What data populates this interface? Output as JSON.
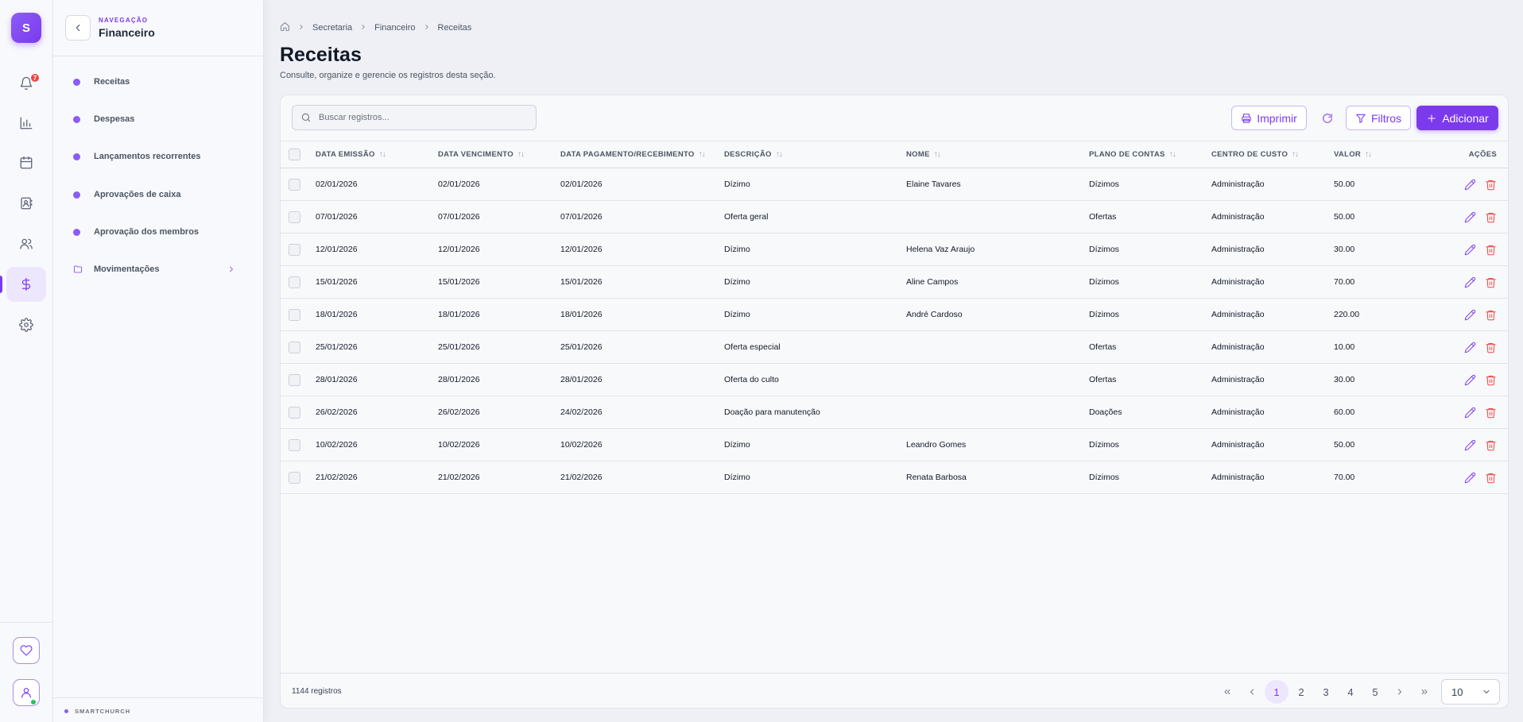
{
  "app": {
    "logo_letter": "S",
    "brand": "SMARTCHURCH"
  },
  "rail": {
    "notifications_count": "7"
  },
  "sidenav": {
    "kicker": "NAVEGAÇÃO",
    "title": "Financeiro",
    "items": [
      {
        "label": "Receitas"
      },
      {
        "label": "Despesas"
      },
      {
        "label": "Lançamentos recorrentes"
      },
      {
        "label": "Aprovações de caixa"
      },
      {
        "label": "Aprovação dos membros"
      },
      {
        "label": "Movimentações"
      }
    ]
  },
  "breadcrumb": [
    "Secretaria",
    "Financeiro",
    "Receitas"
  ],
  "page": {
    "title": "Receitas",
    "subtitle": "Consulte, organize e gerencie os registros desta seção."
  },
  "toolbar": {
    "search_placeholder": "Buscar registros...",
    "print_label": "Imprimir",
    "filters_label": "Filtros",
    "add_label": "Adicionar"
  },
  "table": {
    "columns": [
      "DATA EMISSÃO",
      "DATA VENCIMENTO",
      "DATA PAGAMENTO/RECEBIMENTO",
      "DESCRIÇÃO",
      "NOME",
      "PLANO DE CONTAS",
      "CENTRO DE CUSTO",
      "VALOR"
    ],
    "actions_header": "AÇÕES",
    "rows": [
      [
        "02/01/2026",
        "02/01/2026",
        "02/01/2026",
        "Dízimo",
        "Elaine Tavares",
        "Dízimos",
        "Administração",
        "50.00"
      ],
      [
        "07/01/2026",
        "07/01/2026",
        "07/01/2026",
        "Oferta geral",
        "",
        "Ofertas",
        "Administração",
        "50.00"
      ],
      [
        "12/01/2026",
        "12/01/2026",
        "12/01/2026",
        "Dízimo",
        "Helena Vaz Araujo",
        "Dízimos",
        "Administração",
        "30.00"
      ],
      [
        "15/01/2026",
        "15/01/2026",
        "15/01/2026",
        "Dízimo",
        "Aline Campos",
        "Dízimos",
        "Administração",
        "70.00"
      ],
      [
        "18/01/2026",
        "18/01/2026",
        "18/01/2026",
        "Dízimo",
        "André Cardoso",
        "Dízimos",
        "Administração",
        "220.00"
      ],
      [
        "25/01/2026",
        "25/01/2026",
        "25/01/2026",
        "Oferta especial",
        "",
        "Ofertas",
        "Administração",
        "10.00"
      ],
      [
        "28/01/2026",
        "28/01/2026",
        "28/01/2026",
        "Oferta do culto",
        "",
        "Ofertas",
        "Administração",
        "30.00"
      ],
      [
        "26/02/2026",
        "26/02/2026",
        "24/02/2026",
        "Doação para manutenção",
        "",
        "Doações",
        "Administração",
        "60.00"
      ],
      [
        "10/02/2026",
        "10/02/2026",
        "10/02/2026",
        "Dízimo",
        "Leandro Gomes",
        "Dízimos",
        "Administração",
        "50.00"
      ],
      [
        "21/02/2026",
        "21/02/2026",
        "21/02/2026",
        "Dízimo",
        "Renata Barbosa",
        "Dízimos",
        "Administração",
        "70.00"
      ]
    ]
  },
  "footer": {
    "records": "1144 registros",
    "pages": [
      "1",
      "2",
      "3",
      "4",
      "5"
    ],
    "page_size": "10"
  },
  "colors": {
    "accent": "#7c3aed",
    "danger": "#ef4444"
  }
}
